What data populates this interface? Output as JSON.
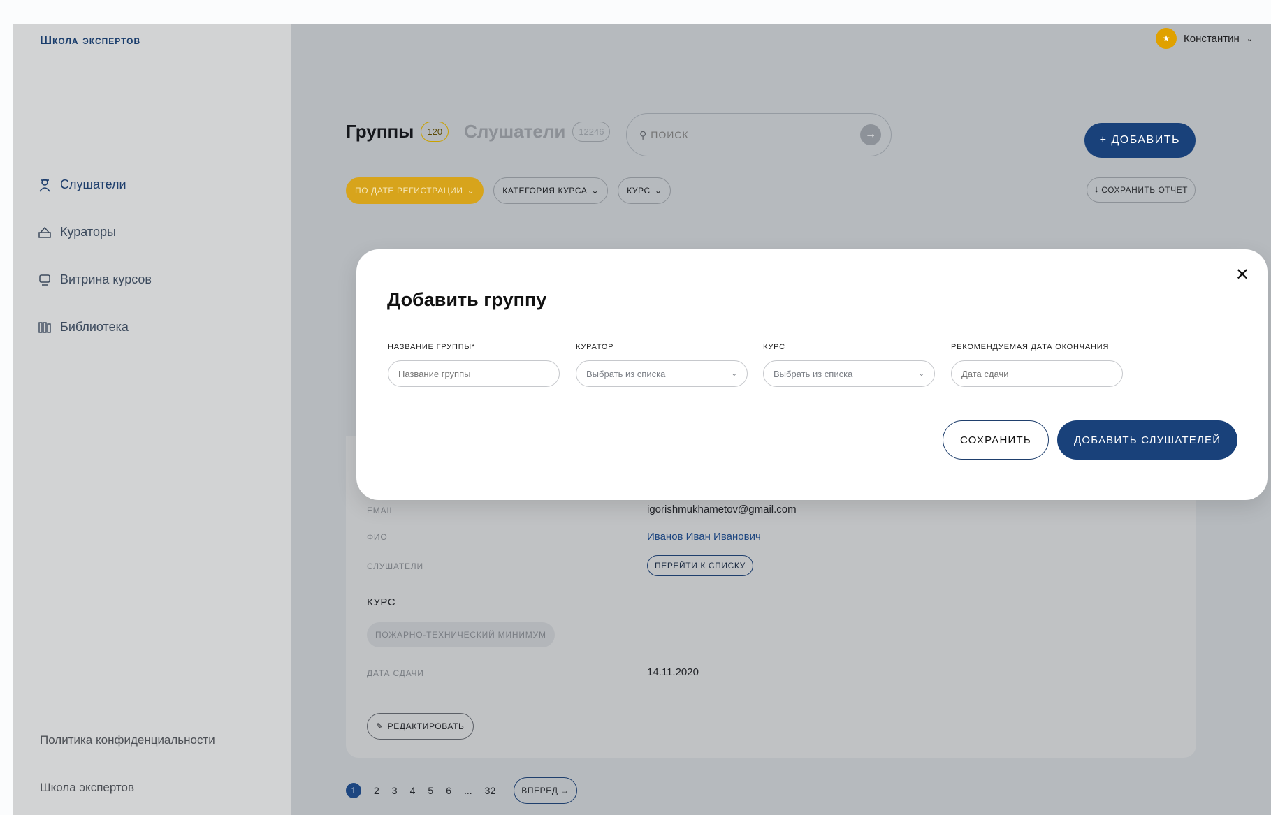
{
  "app": {
    "brand": "Школа экспертов"
  },
  "sidebar": {
    "items": [
      {
        "label": "Слушатели",
        "icon": "students-icon"
      },
      {
        "label": "Кураторы",
        "icon": "curators-icon"
      },
      {
        "label": "Витрина курсов",
        "icon": "courses-icon"
      },
      {
        "label": "Библиотека",
        "icon": "library-icon"
      }
    ],
    "footer": {
      "privacy": "Политика конфиденциальности",
      "school": "Школа экспертов"
    }
  },
  "header": {
    "user_name": "Константин"
  },
  "tabs": [
    {
      "label": "Группы",
      "count": "120"
    },
    {
      "label": "Слушатели",
      "count": "12246"
    }
  ],
  "search": {
    "placeholder": "ПОИСК"
  },
  "toolbar": {
    "add_label": "+ ДОБАВИТЬ",
    "save_report_label": "СОХРАНИТЬ ОТЧЕТ"
  },
  "filters": [
    {
      "label": "ПО ДАТЕ РЕГИСТРАЦИИ"
    },
    {
      "label": "КАТЕГОРИЯ КУРСА"
    },
    {
      "label": "КУРС"
    }
  ],
  "card": {
    "email_label": "EMAIL",
    "email_value": "igorishmukhametov@gmail.com",
    "fio_label": "ФИО",
    "fio_value": "Иванов Иван Иванович",
    "students_label": "СЛУШАТЕЛИ",
    "go_to_list": "ПЕРЕЙТИ К СПИСКУ",
    "course_title": "КУРС",
    "course_tag": "ПОЖАРНО-ТЕХНИЧЕСКИЙ МИНИМУМ",
    "date_label": "ДАТА СДАЧИ",
    "date_value": "14.11.2020",
    "edit_label": "РЕДАКТИРОВАТЬ"
  },
  "pagination": {
    "pages": [
      "1",
      "2",
      "3",
      "4",
      "5",
      "6",
      "...",
      "32"
    ],
    "next_label": "ВПЕРЕД →"
  },
  "modal": {
    "title": "Добавить группу",
    "fields": {
      "group_name": {
        "label": "НАЗВАНИЕ ГРУППЫ*",
        "placeholder": "Название группы"
      },
      "curator": {
        "label": "КУРАТОР",
        "placeholder": "Выбрать из списка"
      },
      "course": {
        "label": "КУРС",
        "placeholder": "Выбрать из списка"
      },
      "end_date": {
        "label": "РЕКОМЕНДУЕМАЯ ДАТА ОКОНЧАНИЯ",
        "placeholder": "Дата сдачи"
      }
    },
    "save_label": "СОХРАНИТЬ",
    "add_students_label": "ДОБАВИТЬ СЛУШАТЕЛЕЙ"
  },
  "colors": {
    "primary": "#19417a",
    "accent": "#d7a41c",
    "overlay": "#b6babe"
  }
}
